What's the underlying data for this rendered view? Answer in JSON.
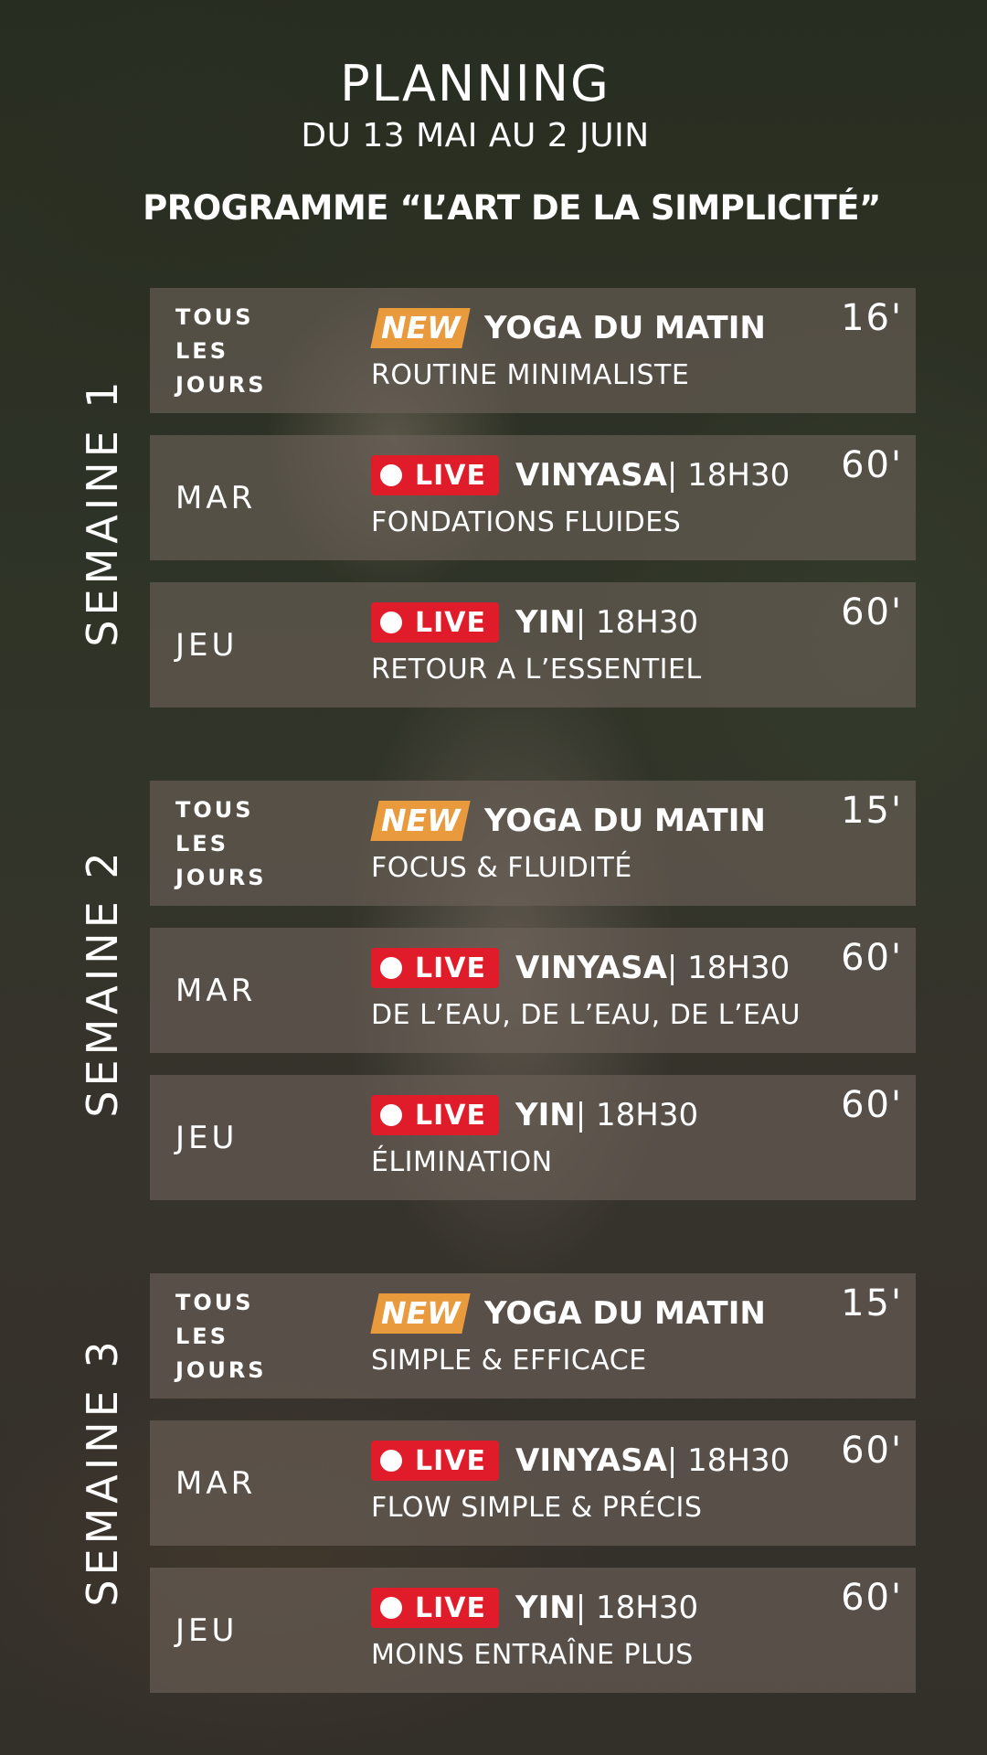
{
  "header": {
    "title": "PLANNING",
    "dates": "DU 13 MAI AU 2 JUIN",
    "program": "PROGRAMME “L’ART DE LA SIMPLICITÉ”"
  },
  "colors": {
    "new_badge": "#e89a3c",
    "live_badge": "#e01b2a"
  },
  "badges": {
    "new": "NEW",
    "live": "LIVE"
  },
  "weeks": [
    {
      "label": "SEMAINE 1",
      "sessions": [
        {
          "day_lines": [
            "TOUS",
            "LES",
            "JOURS"
          ],
          "badge": "new",
          "name": "YOGA DU MATIN",
          "time": "",
          "subtitle": "ROUTINE MINIMALISTE",
          "duration": "16'"
        },
        {
          "day": "MAR",
          "badge": "live",
          "name": "VINYASA",
          "time": " | 18H30",
          "subtitle": "FONDATIONS FLUIDES",
          "duration": "60'"
        },
        {
          "day": "JEU",
          "badge": "live",
          "name": "YIN",
          "time": " | 18H30",
          "subtitle": "RETOUR A L’ESSENTIEL",
          "duration": "60'"
        }
      ]
    },
    {
      "label": "SEMAINE 2",
      "sessions": [
        {
          "day_lines": [
            "TOUS",
            "LES",
            "JOURS"
          ],
          "badge": "new",
          "name": "YOGA DU MATIN",
          "time": "",
          "subtitle": "FOCUS & FLUIDITÉ",
          "duration": "15'"
        },
        {
          "day": "MAR",
          "badge": "live",
          "name": "VINYASA",
          "time": " | 18H30",
          "subtitle": "DE L’EAU, DE L’EAU, DE L’EAU",
          "duration": "60'"
        },
        {
          "day": "JEU",
          "badge": "live",
          "name": "YIN",
          "time": " | 18H30",
          "subtitle": "ÉLIMINATION",
          "duration": "60'"
        }
      ]
    },
    {
      "label": "SEMAINE 3",
      "sessions": [
        {
          "day_lines": [
            "TOUS",
            "LES",
            "JOURS"
          ],
          "badge": "new",
          "name": "YOGA DU MATIN",
          "time": "",
          "subtitle": "SIMPLE & EFFICACE",
          "duration": "15'"
        },
        {
          "day": "MAR",
          "badge": "live",
          "name": "VINYASA",
          "time": " | 18H30",
          "subtitle": "FLOW SIMPLE & PRÉCIS",
          "duration": "60'"
        },
        {
          "day": "JEU",
          "badge": "live",
          "name": "YIN",
          "time": " | 18H30",
          "subtitle": "MOINS ENTRAÎNE PLUS",
          "duration": "60'"
        }
      ]
    }
  ]
}
